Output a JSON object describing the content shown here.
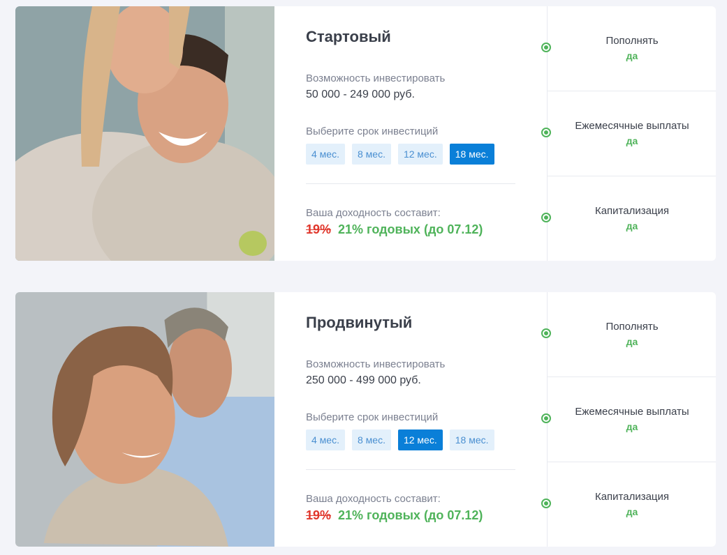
{
  "plans": [
    {
      "title": "Стартовый",
      "invest_label": "Возможность инвестировать",
      "invest_range": "50 000 - 249 000 руб.",
      "term_label": "Выберите срок инвестиций",
      "terms": [
        "4 мес.",
        "8 мес.",
        "12 мес.",
        "18 мес."
      ],
      "selected_term": "18 мес.",
      "yield_label": "Ваша доходность составит:",
      "old_rate": "19%",
      "new_rate": "21% годовых (до 07.12)",
      "photo": "smiling-couple-photo",
      "features": [
        {
          "name": "Пополнять",
          "value": "да"
        },
        {
          "name": "Ежемесячные выплаты",
          "value": "да"
        },
        {
          "name": "Капитализация",
          "value": "да"
        }
      ]
    },
    {
      "title": "Продвинутый",
      "invest_label": "Возможность инвестировать",
      "invest_range": "250 000 - 499 000 руб.",
      "term_label": "Выберите срок инвестиций",
      "terms": [
        "4 мес.",
        "8 мес.",
        "12 мес.",
        "18 мес."
      ],
      "selected_term": "12 мес.",
      "yield_label": "Ваша доходность составит:",
      "old_rate": "19%",
      "new_rate": "21% годовых (до 07.12)",
      "photo": "mature-couple-photo",
      "features": [
        {
          "name": "Пополнять",
          "value": "да"
        },
        {
          "name": "Ежемесячные выплаты",
          "value": "да"
        },
        {
          "name": "Капитализация",
          "value": "да"
        }
      ]
    }
  ],
  "colors": {
    "accent": "#0a7fd8",
    "term_bg": "#e3f0fb",
    "green": "#4fb35a",
    "red": "#e0372c"
  }
}
